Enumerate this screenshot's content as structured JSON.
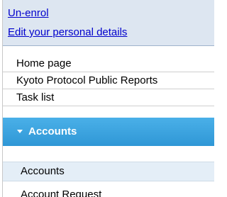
{
  "user_links": {
    "unenrol": "Un-enrol",
    "edit_details": "Edit your personal details"
  },
  "nav": {
    "home": "Home page",
    "kyoto": "Kyoto Protocol Public Reports",
    "tasks": "Task list"
  },
  "accounts_section": {
    "title": "Accounts",
    "expanded_icon": "chevron-down-icon",
    "items": [
      {
        "label": "Accounts",
        "active": true
      },
      {
        "label": "Account Request",
        "active": false
      }
    ]
  },
  "colors": {
    "header_blue": "#3aa3de",
    "link_blue": "#0000cc",
    "user_box_bg": "#dde6f1",
    "active_item_bg": "#e4eef7"
  }
}
